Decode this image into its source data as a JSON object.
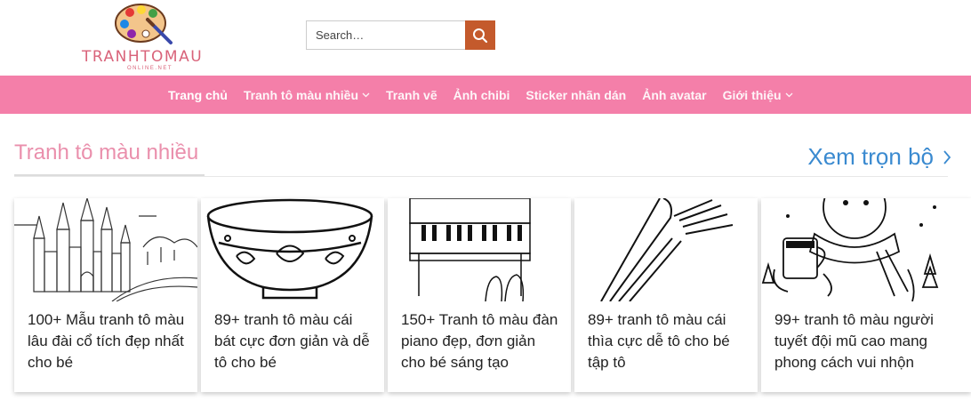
{
  "brand": {
    "name": "TRANHTOMAU",
    "sub": "ONLINE.NET"
  },
  "search": {
    "placeholder": "Search…"
  },
  "nav": [
    {
      "label": "Trang chủ",
      "dropdown": false
    },
    {
      "label": "Tranh tô màu nhiều",
      "dropdown": true
    },
    {
      "label": "Tranh vẽ",
      "dropdown": false
    },
    {
      "label": "Ảnh chibi",
      "dropdown": false
    },
    {
      "label": "Sticker nhãn dán",
      "dropdown": false
    },
    {
      "label": "Ảnh avatar",
      "dropdown": false
    },
    {
      "label": "Giới thiệu",
      "dropdown": true
    }
  ],
  "section": {
    "title": "Tranh tô màu nhiều",
    "view_all": "Xem trọn bộ"
  },
  "cards": [
    {
      "title": "100+ Mẫu tranh tô màu lâu đài cổ tích đẹp nhất cho bé",
      "image": "castle-coloring-image"
    },
    {
      "title": "89+ tranh tô màu cái bát cực đơn giản và dễ tô cho bé",
      "image": "bowl-coloring-image"
    },
    {
      "title": "150+ Tranh tô màu đàn piano đẹp, đơn giản cho bé sáng tạo",
      "image": "piano-coloring-image"
    },
    {
      "title": "89+ tranh tô màu cái thìa cực dễ tô cho bé tập tô",
      "image": "spoon-coloring-image"
    },
    {
      "title": "99+ tranh tô màu người tuyết đội mũ cao mang phong cách vui nhộn",
      "image": "snowman-coloring-image"
    }
  ],
  "colors": {
    "nav_bg": "#f47fa9",
    "search_btn": "#c45a2c",
    "section_title": "#ea8fac",
    "view_all": "#3a8ad0"
  }
}
